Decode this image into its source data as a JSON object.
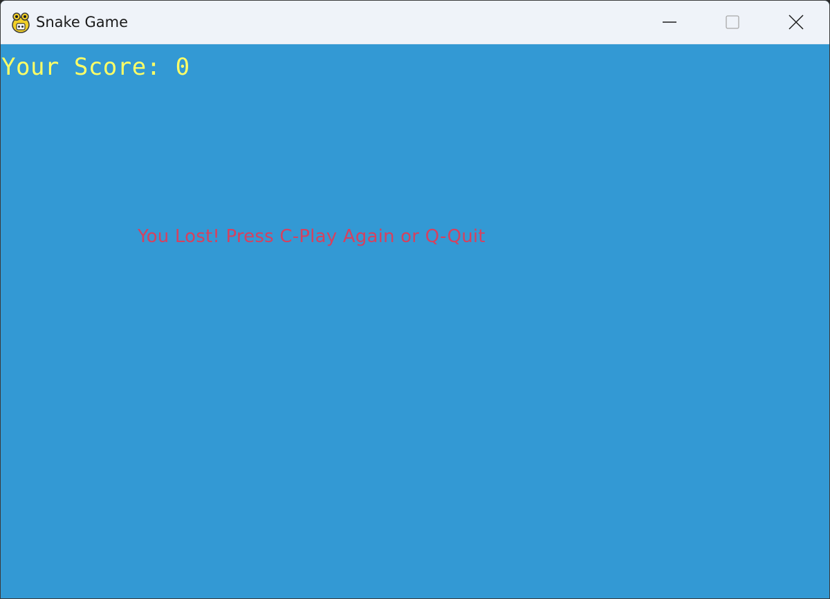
{
  "window": {
    "title": "Snake Game",
    "app_icon": "pygame-snake-icon",
    "controls": {
      "minimize_icon": "minimize-icon",
      "maximize_icon": "maximize-icon",
      "close_icon": "close-icon"
    }
  },
  "game": {
    "background_color": "#3399d4",
    "score_text": "Your Score: 0",
    "score_color": "#ffff66",
    "message_text": "You Lost! Press C-Play Again or Q-Quit",
    "message_color": "#d6415f"
  }
}
